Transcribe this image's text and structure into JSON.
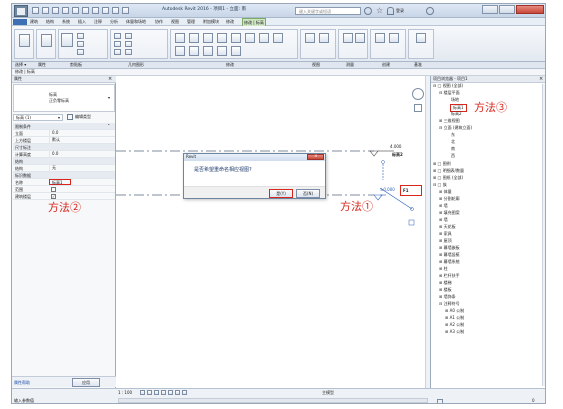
{
  "app": {
    "title": "Autodesk Revit 2016 - 项目1 - 立面: 南",
    "search_placeholder": "键入关键字或短语",
    "user": "登录"
  },
  "ribbon_tabs": [
    "建筑",
    "结构",
    "系统",
    "插入",
    "注释",
    "分析",
    "体量和场地",
    "协作",
    "视图",
    "管理",
    "附加模块",
    "修改",
    "修改 | 标高"
  ],
  "panels": [
    "选择 ▾",
    "属性",
    "剪贴板",
    "几何图形",
    "修改",
    "视图",
    "测量",
    "创建",
    "基准"
  ],
  "context_label": "修改 | 标高",
  "properties": {
    "title": "属性",
    "type_main": "标高",
    "type_sub": "正负零标高",
    "selector": "标高 (1)",
    "edit_type": "编辑类型",
    "sections": {
      "constraints": "限制条件",
      "dimensions": "尺寸标注",
      "structure": "结构",
      "identity": "标识数据",
      "extents": "范围"
    },
    "rows": {
      "elevation_label": "立面",
      "elevation_value": "0.0",
      "above_label": "上方楼层",
      "above_value": "默认",
      "calc_height_label": "计算高度",
      "calc_height_value": "0.0",
      "struct_label": "结构",
      "struct_value": "无",
      "name_label": "名称",
      "name_value": "标高1",
      "building_level_label": "建筑楼层",
      "story_label": "建筑楼层"
    },
    "help": "属性帮助",
    "apply": "应用"
  },
  "dialog": {
    "title": "Revit",
    "message": "是否希望重命名相应视图?",
    "yes": "是(Y)",
    "no": "否(N)"
  },
  "canvas": {
    "upper_level_value": "4.000",
    "upper_level_name": "标高2",
    "lower_level_value": "±0.000",
    "lower_level_name": "F1"
  },
  "annotations": {
    "method1": "方法①",
    "method2": "方法②",
    "method3": "方法③"
  },
  "browser": {
    "title": "项目浏览器 - 项目1",
    "items": [
      {
        "label": "视图 (全部)",
        "level": 0
      },
      {
        "label": "楼层平面",
        "level": 1
      },
      {
        "label": "场地",
        "level": 3
      },
      {
        "label": "标高1",
        "level": 3
      },
      {
        "label": "标高2",
        "level": 3
      },
      {
        "label": "三维视图",
        "level": 1
      },
      {
        "label": "立面 (建筑立面)",
        "level": 1
      },
      {
        "label": "东",
        "level": 3
      },
      {
        "label": "北",
        "level": 3
      },
      {
        "label": "南",
        "level": 3
      },
      {
        "label": "西",
        "level": 3
      },
      {
        "label": "图例",
        "level": 0
      },
      {
        "label": "明细表/数量",
        "level": 0
      },
      {
        "label": "图纸 (全部)",
        "level": 0
      },
      {
        "label": "族",
        "level": 0
      },
      {
        "label": "体量",
        "level": 1
      },
      {
        "label": "分割轮廓",
        "level": 1
      },
      {
        "label": "墙",
        "level": 1
      },
      {
        "label": "填充图案",
        "level": 1
      },
      {
        "label": "墙",
        "level": 1
      },
      {
        "label": "天花板",
        "level": 1
      },
      {
        "label": "家具",
        "level": 1
      },
      {
        "label": "屋顶",
        "level": 1
      },
      {
        "label": "幕墙嵌板",
        "level": 1
      },
      {
        "label": "幕墙竖梃",
        "level": 1
      },
      {
        "label": "幕墙系统",
        "level": 1
      },
      {
        "label": "柱",
        "level": 1
      },
      {
        "label": "栏杆扶手",
        "level": 1
      },
      {
        "label": "楼梯",
        "level": 1
      },
      {
        "label": "楼板",
        "level": 1
      },
      {
        "label": "墙饰条",
        "level": 1
      },
      {
        "label": "注释符号",
        "level": 1
      },
      {
        "label": "A0 公制",
        "level": 2
      },
      {
        "label": "A1 公制",
        "level": 2
      },
      {
        "label": "A2 公制",
        "level": 2
      },
      {
        "label": "A3 公制",
        "level": 2
      }
    ]
  },
  "status": {
    "prompt": "输入参数值",
    "scale": "1 : 100",
    "model": "主模型",
    "filter_count": "0"
  }
}
